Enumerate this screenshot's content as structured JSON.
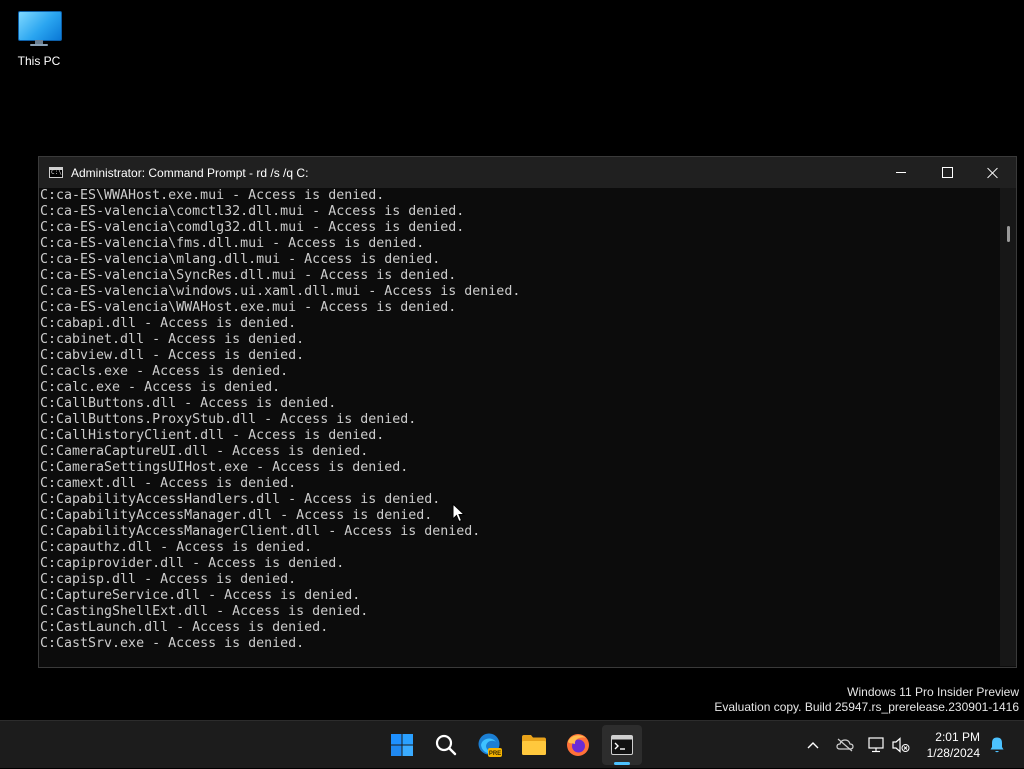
{
  "desktop": {
    "icons": [
      {
        "label": "This PC",
        "icon": "monitor-icon"
      }
    ]
  },
  "window": {
    "title": "Administrator: Command Prompt - rd  /s /q C:",
    "icon": "cmd-icon",
    "controls": [
      "minimize",
      "maximize",
      "close"
    ]
  },
  "console": {
    "lines": [
      "C:ca-ES\\WWAHost.exe.mui - Access is denied.",
      "C:ca-ES-valencia\\comctl32.dll.mui - Access is denied.",
      "C:ca-ES-valencia\\comdlg32.dll.mui - Access is denied.",
      "C:ca-ES-valencia\\fms.dll.mui - Access is denied.",
      "C:ca-ES-valencia\\mlang.dll.mui - Access is denied.",
      "C:ca-ES-valencia\\SyncRes.dll.mui - Access is denied.",
      "C:ca-ES-valencia\\windows.ui.xaml.dll.mui - Access is denied.",
      "C:ca-ES-valencia\\WWAHost.exe.mui - Access is denied.",
      "C:cabapi.dll - Access is denied.",
      "C:cabinet.dll - Access is denied.",
      "C:cabview.dll - Access is denied.",
      "C:cacls.exe - Access is denied.",
      "C:calc.exe - Access is denied.",
      "C:CallButtons.dll - Access is denied.",
      "C:CallButtons.ProxyStub.dll - Access is denied.",
      "C:CallHistoryClient.dll - Access is denied.",
      "C:CameraCaptureUI.dll - Access is denied.",
      "C:CameraSettingsUIHost.exe - Access is denied.",
      "C:camext.dll - Access is denied.",
      "C:CapabilityAccessHandlers.dll - Access is denied.",
      "C:CapabilityAccessManager.dll - Access is denied.",
      "C:CapabilityAccessManagerClient.dll - Access is denied.",
      "C:capauthz.dll - Access is denied.",
      "C:capiprovider.dll - Access is denied.",
      "C:capisp.dll - Access is denied.",
      "C:CaptureService.dll - Access is denied.",
      "C:CastingShellExt.dll - Access is denied.",
      "C:CastLaunch.dll - Access is denied.",
      "C:CastSrv.exe - Access is denied."
    ]
  },
  "watermark": {
    "line1": "Windows 11 Pro Insider Preview",
    "line2": "Evaluation copy. Build 25947.rs_prerelease.230901-1416"
  },
  "taskbar": {
    "apps": [
      {
        "name": "start-button",
        "icon": "windows-logo-icon"
      },
      {
        "name": "search-button",
        "icon": "search-icon"
      },
      {
        "name": "edge-button",
        "icon": "edge-pre-icon"
      },
      {
        "name": "file-explorer-button",
        "icon": "folder-icon"
      },
      {
        "name": "firefox-button",
        "icon": "firefox-icon"
      },
      {
        "name": "terminal-button",
        "icon": "terminal-icon",
        "active": true
      }
    ],
    "tray": [
      "chevron-up-icon",
      "onedrive-offline-icon",
      "network-icon",
      "volume-muted-icon"
    ],
    "clock": {
      "time": "2:01 PM",
      "date": "1/28/2024"
    },
    "notification_icon": "bell-icon",
    "accent": "#4cc2ff"
  }
}
